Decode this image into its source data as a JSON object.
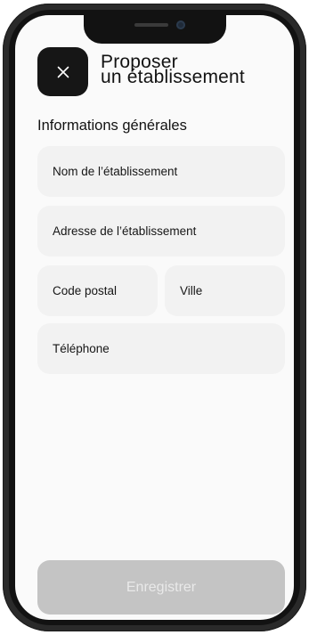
{
  "header": {
    "close_icon": "close-icon",
    "title_line1": "Proposer",
    "title_line2": "un établissement"
  },
  "section": {
    "title": "Informations générales"
  },
  "form": {
    "name_placeholder": "Nom de l’établissement",
    "address_placeholder": "Adresse de l’établissement",
    "postal_placeholder": "Code postal",
    "city_placeholder": "Ville",
    "phone_placeholder": "Téléphone"
  },
  "footer": {
    "save_label": "Enregistrer"
  },
  "colors": {
    "screen_background": "#fafafa",
    "field_background": "#f2f2f2",
    "close_button_background": "#161616",
    "save_button_disabled": "#c4c4c4",
    "text_primary": "#121212",
    "device_frame": "#2a2a2a"
  }
}
